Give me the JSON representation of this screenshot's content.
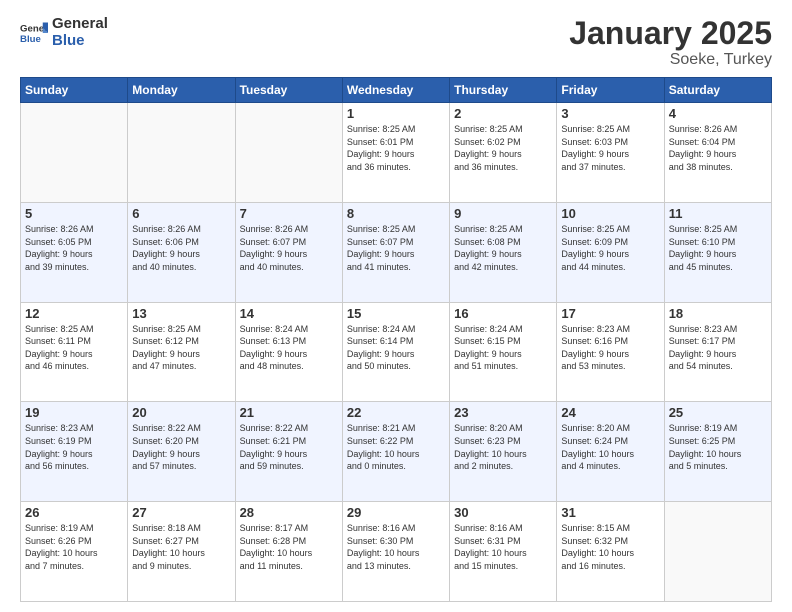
{
  "header": {
    "logo_general": "General",
    "logo_blue": "Blue",
    "month": "January 2025",
    "location": "Soeke, Turkey"
  },
  "weekdays": [
    "Sunday",
    "Monday",
    "Tuesday",
    "Wednesday",
    "Thursday",
    "Friday",
    "Saturday"
  ],
  "weeks": [
    [
      {
        "day": "",
        "info": ""
      },
      {
        "day": "",
        "info": ""
      },
      {
        "day": "",
        "info": ""
      },
      {
        "day": "1",
        "info": "Sunrise: 8:25 AM\nSunset: 6:01 PM\nDaylight: 9 hours\nand 36 minutes."
      },
      {
        "day": "2",
        "info": "Sunrise: 8:25 AM\nSunset: 6:02 PM\nDaylight: 9 hours\nand 36 minutes."
      },
      {
        "day": "3",
        "info": "Sunrise: 8:25 AM\nSunset: 6:03 PM\nDaylight: 9 hours\nand 37 minutes."
      },
      {
        "day": "4",
        "info": "Sunrise: 8:26 AM\nSunset: 6:04 PM\nDaylight: 9 hours\nand 38 minutes."
      }
    ],
    [
      {
        "day": "5",
        "info": "Sunrise: 8:26 AM\nSunset: 6:05 PM\nDaylight: 9 hours\nand 39 minutes."
      },
      {
        "day": "6",
        "info": "Sunrise: 8:26 AM\nSunset: 6:06 PM\nDaylight: 9 hours\nand 40 minutes."
      },
      {
        "day": "7",
        "info": "Sunrise: 8:26 AM\nSunset: 6:07 PM\nDaylight: 9 hours\nand 40 minutes."
      },
      {
        "day": "8",
        "info": "Sunrise: 8:25 AM\nSunset: 6:07 PM\nDaylight: 9 hours\nand 41 minutes."
      },
      {
        "day": "9",
        "info": "Sunrise: 8:25 AM\nSunset: 6:08 PM\nDaylight: 9 hours\nand 42 minutes."
      },
      {
        "day": "10",
        "info": "Sunrise: 8:25 AM\nSunset: 6:09 PM\nDaylight: 9 hours\nand 44 minutes."
      },
      {
        "day": "11",
        "info": "Sunrise: 8:25 AM\nSunset: 6:10 PM\nDaylight: 9 hours\nand 45 minutes."
      }
    ],
    [
      {
        "day": "12",
        "info": "Sunrise: 8:25 AM\nSunset: 6:11 PM\nDaylight: 9 hours\nand 46 minutes."
      },
      {
        "day": "13",
        "info": "Sunrise: 8:25 AM\nSunset: 6:12 PM\nDaylight: 9 hours\nand 47 minutes."
      },
      {
        "day": "14",
        "info": "Sunrise: 8:24 AM\nSunset: 6:13 PM\nDaylight: 9 hours\nand 48 minutes."
      },
      {
        "day": "15",
        "info": "Sunrise: 8:24 AM\nSunset: 6:14 PM\nDaylight: 9 hours\nand 50 minutes."
      },
      {
        "day": "16",
        "info": "Sunrise: 8:24 AM\nSunset: 6:15 PM\nDaylight: 9 hours\nand 51 minutes."
      },
      {
        "day": "17",
        "info": "Sunrise: 8:23 AM\nSunset: 6:16 PM\nDaylight: 9 hours\nand 53 minutes."
      },
      {
        "day": "18",
        "info": "Sunrise: 8:23 AM\nSunset: 6:17 PM\nDaylight: 9 hours\nand 54 minutes."
      }
    ],
    [
      {
        "day": "19",
        "info": "Sunrise: 8:23 AM\nSunset: 6:19 PM\nDaylight: 9 hours\nand 56 minutes."
      },
      {
        "day": "20",
        "info": "Sunrise: 8:22 AM\nSunset: 6:20 PM\nDaylight: 9 hours\nand 57 minutes."
      },
      {
        "day": "21",
        "info": "Sunrise: 8:22 AM\nSunset: 6:21 PM\nDaylight: 9 hours\nand 59 minutes."
      },
      {
        "day": "22",
        "info": "Sunrise: 8:21 AM\nSunset: 6:22 PM\nDaylight: 10 hours\nand 0 minutes."
      },
      {
        "day": "23",
        "info": "Sunrise: 8:20 AM\nSunset: 6:23 PM\nDaylight: 10 hours\nand 2 minutes."
      },
      {
        "day": "24",
        "info": "Sunrise: 8:20 AM\nSunset: 6:24 PM\nDaylight: 10 hours\nand 4 minutes."
      },
      {
        "day": "25",
        "info": "Sunrise: 8:19 AM\nSunset: 6:25 PM\nDaylight: 10 hours\nand 5 minutes."
      }
    ],
    [
      {
        "day": "26",
        "info": "Sunrise: 8:19 AM\nSunset: 6:26 PM\nDaylight: 10 hours\nand 7 minutes."
      },
      {
        "day": "27",
        "info": "Sunrise: 8:18 AM\nSunset: 6:27 PM\nDaylight: 10 hours\nand 9 minutes."
      },
      {
        "day": "28",
        "info": "Sunrise: 8:17 AM\nSunset: 6:28 PM\nDaylight: 10 hours\nand 11 minutes."
      },
      {
        "day": "29",
        "info": "Sunrise: 8:16 AM\nSunset: 6:30 PM\nDaylight: 10 hours\nand 13 minutes."
      },
      {
        "day": "30",
        "info": "Sunrise: 8:16 AM\nSunset: 6:31 PM\nDaylight: 10 hours\nand 15 minutes."
      },
      {
        "day": "31",
        "info": "Sunrise: 8:15 AM\nSunset: 6:32 PM\nDaylight: 10 hours\nand 16 minutes."
      },
      {
        "day": "",
        "info": ""
      }
    ]
  ]
}
